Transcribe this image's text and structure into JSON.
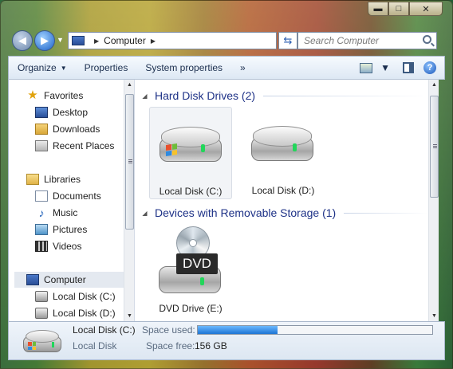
{
  "window": {
    "caption_minimize": "▬",
    "caption_maximize": "□",
    "caption_close": "✕"
  },
  "nav": {
    "back_glyph": "◀",
    "forward_glyph": "▶",
    "recent_glyph": "▼",
    "address_crumb": "Computer",
    "address_sep": "▶",
    "address_tail_sep": "▶",
    "refresh_glyph": "⇆",
    "search_placeholder": "Search Computer"
  },
  "toolbar": {
    "organize": "Organize",
    "organize_arrow": "▼",
    "properties": "Properties",
    "system_properties": "System properties",
    "more": "»",
    "view_arrow": "▼",
    "help": "?"
  },
  "sidebar": {
    "favorites": {
      "label": "Favorites",
      "icon": "star-icon"
    },
    "favorites_items": [
      {
        "label": "Desktop",
        "icon": "desktop-icon"
      },
      {
        "label": "Downloads",
        "icon": "downloads-folder-icon"
      },
      {
        "label": "Recent Places",
        "icon": "recent-places-icon"
      }
    ],
    "libraries": {
      "label": "Libraries",
      "icon": "libraries-icon"
    },
    "library_items": [
      {
        "label": "Documents",
        "icon": "documents-icon"
      },
      {
        "label": "Music",
        "icon": "music-icon"
      },
      {
        "label": "Pictures",
        "icon": "pictures-icon"
      },
      {
        "label": "Videos",
        "icon": "videos-icon"
      }
    ],
    "computer": {
      "label": "Computer",
      "icon": "computer-icon"
    },
    "computer_items": [
      {
        "label": "Local Disk (C:)",
        "icon": "local-disk-icon"
      },
      {
        "label": "Local Disk (D:)",
        "icon": "local-disk-icon"
      }
    ]
  },
  "content": {
    "group_hdd": "Hard Disk Drives (2)",
    "group_removable": "Devices with Removable Storage (1)",
    "drives": [
      {
        "label": "Local Disk (C:)",
        "selected": true
      },
      {
        "label": "Local Disk (D:)",
        "selected": false
      }
    ],
    "removable": [
      {
        "label": "DVD Drive (E:)",
        "badge": "DVD"
      }
    ]
  },
  "details": {
    "name": "Local Disk (C:)",
    "type": "Local Disk",
    "space_used_label": "Space used:",
    "space_free_label": "Space free:",
    "space_free_value": "156 GB",
    "space_used_fraction": 0.34
  },
  "colors": {
    "group_header": "#1e3287",
    "progress_fill": "#1d74d4",
    "drive_led": "#22d65a"
  }
}
